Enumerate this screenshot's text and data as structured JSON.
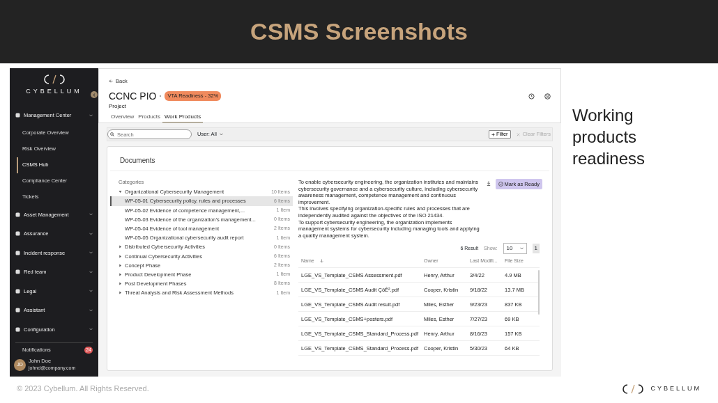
{
  "slide": {
    "title": "CSMS Screenshots",
    "caption": "Working products readiness",
    "footer": "© 2023 Cybellum. All Rights Reserved.",
    "footer_brand": "CYBELLUM"
  },
  "sidebar": {
    "brand": "CYBELLUM",
    "items": [
      {
        "label": "Management Center",
        "children": [
          {
            "label": "Corporate Overview",
            "selected": false
          },
          {
            "label": "Risk Overview",
            "selected": false
          },
          {
            "label": "CSMS Hub",
            "selected": true
          },
          {
            "label": "Compliance Center",
            "selected": false
          },
          {
            "label": "Tickets",
            "selected": false
          }
        ]
      },
      {
        "label": "Asset Management"
      },
      {
        "label": "Assurance"
      },
      {
        "label": "Incident response"
      },
      {
        "label": "Red team"
      },
      {
        "label": "Legal"
      },
      {
        "label": "Assistant"
      },
      {
        "label": "Configuration"
      }
    ],
    "notifications": {
      "label": "Notifications",
      "count": "24"
    },
    "user": {
      "initials": "JD",
      "name": "John Doe",
      "email": "johnd@company.com"
    }
  },
  "header": {
    "back": "Back",
    "title": "CCNC PIO",
    "badge": "VTA Readiness - 32%",
    "subtitle": "Project",
    "tabs": [
      {
        "label": "Overview",
        "selected": false
      },
      {
        "label": "Products",
        "selected": false
      },
      {
        "label": "Work Products",
        "selected": true
      }
    ]
  },
  "toolbar": {
    "search_placeholder": "Search",
    "user_filter": "User: All",
    "filter": "Filter",
    "clear": "Clear Filters"
  },
  "documents": {
    "title": "Documents",
    "categories_label": "Categories",
    "categories": [
      {
        "label": "Organizational Cybersecurity Management",
        "count": "10 Items",
        "expanded": true,
        "children": [
          {
            "label": "WP-05-01 Cybersecurity policy, rules and processes",
            "count": "6 Items",
            "selected": true
          },
          {
            "label": "WP-05-02 Evidence of competence management,...",
            "count": "1 Item",
            "selected": false
          },
          {
            "label": "WP-05-03 Evidence of the organization’s management...",
            "count": "0 Items",
            "selected": false
          },
          {
            "label": "WP-05-04 Evidence of tool management",
            "count": "2 Items",
            "selected": false
          },
          {
            "label": "WP-05-05 Organizational cybersecurity audit report",
            "count": "1 Item",
            "selected": false
          }
        ]
      },
      {
        "label": "Distributed Cybersecurity Activities",
        "count": "0 Items",
        "expanded": false
      },
      {
        "label": "Continual Cybersecurity Activities",
        "count": "6 Items",
        "expanded": false
      },
      {
        "label": "Concept Phase",
        "count": "2 Items",
        "expanded": false
      },
      {
        "label": "Product Development Phase",
        "count": "1 Item",
        "expanded": false
      },
      {
        "label": "Post Development Phases",
        "count": "8 Items",
        "expanded": false
      },
      {
        "label": "Threat Analysis and Risk Assessment Methods",
        "count": "1 Item",
        "expanded": false
      }
    ],
    "description": "To enable cybersecurity engineering, the organization institutes and maintains cybersecurity governance and a cybersecurity culture, including cybersecurity awareness management, competence management and continuous improvement.\nThis involves specifying organization-specific rules and processes that are independently audited against the objectives of the ISO 21434.\nTo support cybersecurity engineering, the organization implements management systems for cybersecurity including managing tools and applying a quality management system.",
    "mark_button": "Mark as Ready",
    "result": "6 Result",
    "show_label": "Show:",
    "page_size": "10",
    "page": "1",
    "table": {
      "columns": [
        "Name",
        "Owner",
        "Last Modifi...",
        "File Size"
      ],
      "rows": [
        [
          "LGE_VS_Template_CSMS Assessment.pdf",
          "Henry, Arthur",
          "3/4/22",
          "4.9 MB"
        ],
        [
          "LGE_VS_Template_CSMS Audit ÇöÊ².pdf",
          "Cooper, Kristin",
          "9/18/22",
          "13.7 MB"
        ],
        [
          "LGE_VS_Template_CSMS Audit result.pdf",
          "Miles, Esther",
          "9/23/23",
          "837 KB"
        ],
        [
          "LGE_VS_Template_CSMS+posters.pdf",
          "Miles, Esther",
          "7/27/23",
          "69 KB"
        ],
        [
          "LGE_VS_Template_CSMS_Standard_Process.pdf",
          "Henry, Arthur",
          "8/16/23",
          "157 KB"
        ],
        [
          "LGE_VS_Template_CSMS_Standard_Process.pdf",
          "Cooper, Kristin",
          "5/30/23",
          "64 KB"
        ]
      ]
    }
  }
}
